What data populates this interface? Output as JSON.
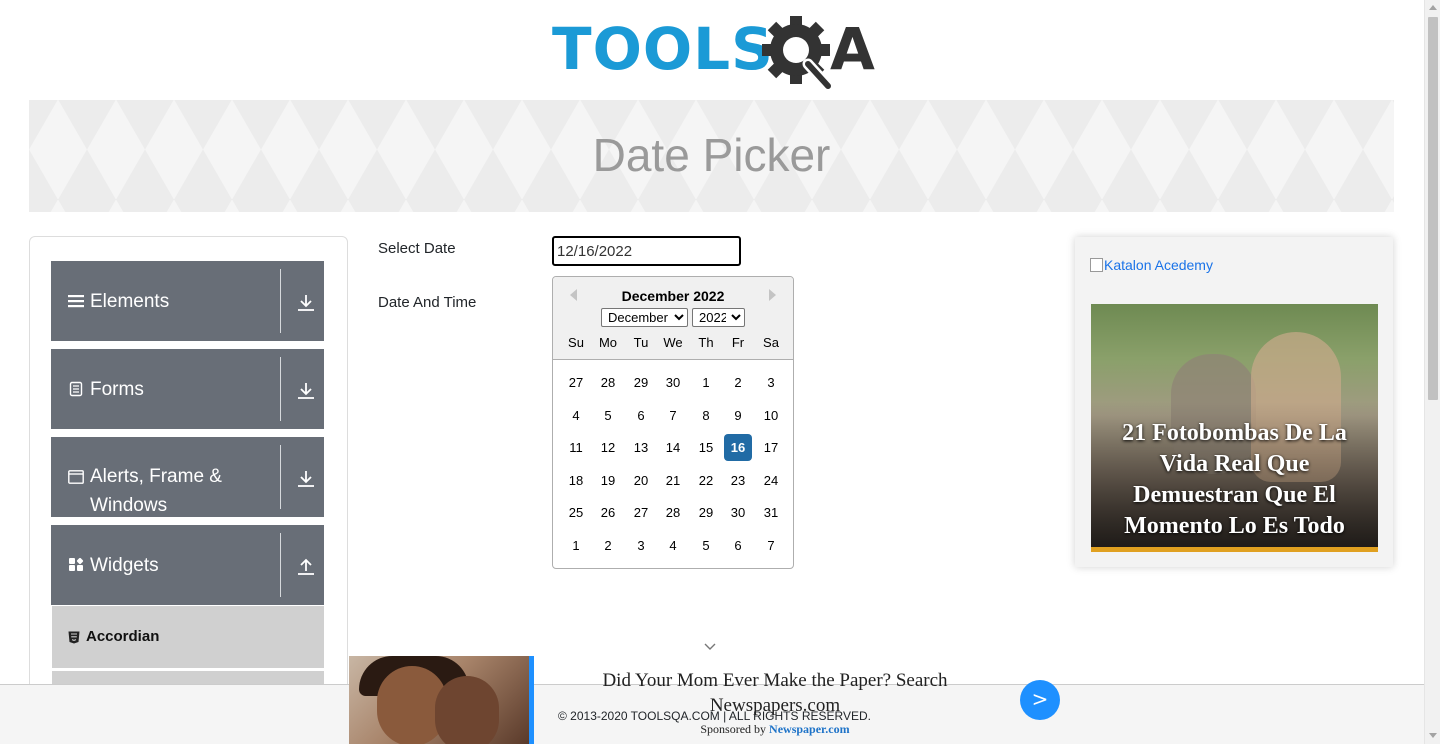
{
  "logo": {
    "text": "TOOLS",
    "letter_a": "A",
    "primary_color": "#1b9ad6",
    "dark_color": "#333333"
  },
  "banner": {
    "title": "Date Picker"
  },
  "sidebar": {
    "groups": [
      {
        "label": "Elements",
        "icon": "hamburger-icon",
        "arrow": "download-icon"
      },
      {
        "label": "Forms",
        "icon": "document-icon",
        "arrow": "download-icon"
      },
      {
        "label": "Alerts, Frame & Windows",
        "icon": "window-icon",
        "arrow": "download-icon"
      },
      {
        "label": "Widgets",
        "icon": "widgets-icon",
        "arrow": "upload-icon"
      }
    ],
    "items": [
      {
        "label": "Accordian",
        "icon": "html5-icon"
      }
    ],
    "header_color": "#686e77"
  },
  "form": {
    "select_date_label": "Select Date",
    "date_time_label": "Date And Time",
    "date_value": "12/16/2022"
  },
  "calendar": {
    "title": "December 2022",
    "selected_month": "December",
    "selected_year": "2022",
    "weekdays": [
      "Su",
      "Mo",
      "Tu",
      "We",
      "Th",
      "Fr",
      "Sa"
    ],
    "weeks": [
      [
        "27",
        "28",
        "29",
        "30",
        "1",
        "2",
        "3"
      ],
      [
        "4",
        "5",
        "6",
        "7",
        "8",
        "9",
        "10"
      ],
      [
        "11",
        "12",
        "13",
        "14",
        "15",
        "16",
        "17"
      ],
      [
        "18",
        "19",
        "20",
        "21",
        "22",
        "23",
        "24"
      ],
      [
        "25",
        "26",
        "27",
        "28",
        "29",
        "30",
        "31"
      ],
      [
        "1",
        "2",
        "3",
        "4",
        "5",
        "6",
        "7"
      ]
    ],
    "selected_day": "16",
    "selected_color": "#216ba5"
  },
  "ad": {
    "image_alt": "Katalon Acedemy",
    "headline": "21 Fotobombas De La Vida Real Que Demuestran Que El Momento Lo Es Todo"
  },
  "bottom_ad": {
    "headline": "Did Your Mom Ever Make the Paper? Search Newspapers.com",
    "sponsor_prefix": "Sponsored by",
    "sponsor_brand": "Newspaper.com",
    "button_label": ">",
    "accent_color": "#1e90ff"
  },
  "footer": {
    "text": "© 2013-2020 TOOLSQA.COM | ALL RIGHTS RESERVED."
  }
}
